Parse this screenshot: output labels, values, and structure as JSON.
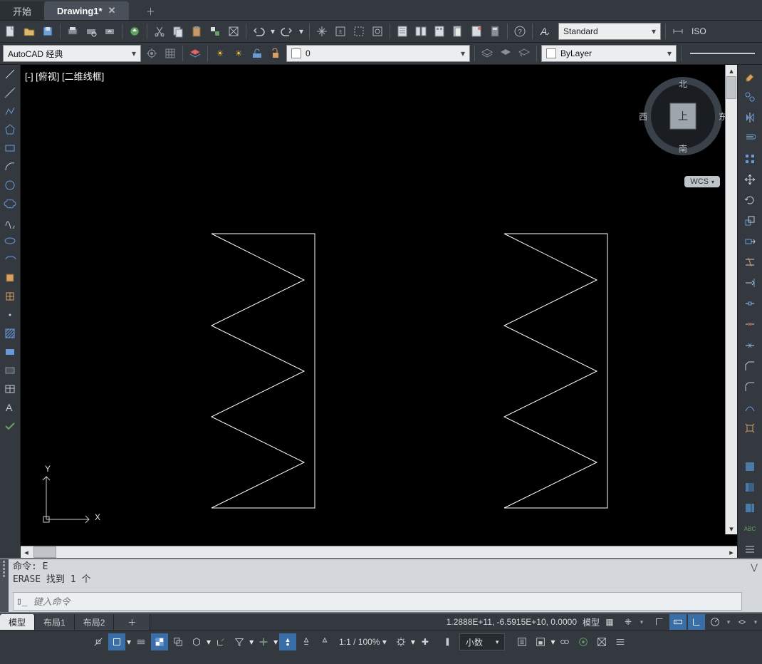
{
  "tabs": {
    "start": "开始",
    "drawing": "Drawing1*"
  },
  "style_combo": "Standard",
  "iso_label": "ISO",
  "workspace_combo": "AutoCAD 经典",
  "layer_combo": "0",
  "lineweight_combo": "ByLayer",
  "viewport_label": "[-] [俯视] [二维线框]",
  "viewcube": {
    "n": "北",
    "s": "南",
    "e": "东",
    "w": "西",
    "top": "上"
  },
  "wcs": "WCS",
  "ucs": {
    "x": "X",
    "y": "Y"
  },
  "cmd_history": "命令: E\nERASE 找到 1 个",
  "cmd_placeholder": "键入命令",
  "layout_tabs": {
    "model": "模型",
    "layout1": "布局1",
    "layout2": "布局2"
  },
  "coords": "1.2888E+11, -6.5915E+10, 0.0000",
  "status_model": "模型",
  "zoom": "1:1 / 100%",
  "units": "小数"
}
